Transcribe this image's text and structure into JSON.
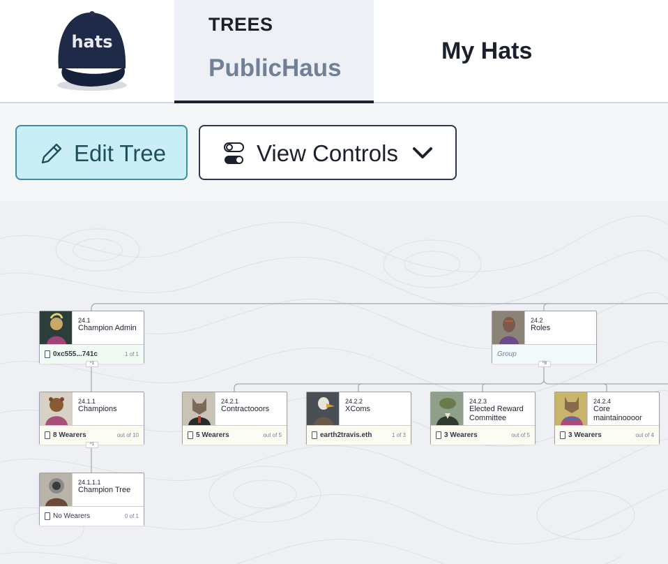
{
  "header": {
    "logo_text": "hats",
    "tab_trees": {
      "label": "TREES",
      "sub": "PublicHaus"
    },
    "tab_my_hats": "My Hats"
  },
  "toolbar": {
    "edit_label": "Edit Tree",
    "view_label": "View Controls"
  },
  "colors": {
    "edit_bg": "#c9eef5",
    "edit_border": "#3c8ea4",
    "text_dark": "#1a202c",
    "tab_active_bg": "#edf1f5"
  },
  "hats": [
    {
      "id": "24.1",
      "name": "Champion Admin",
      "footer": "0xc555...741c",
      "count": "1 of 1",
      "toggle": "^1"
    },
    {
      "id": "24.2",
      "name": "Roles",
      "footer": "Group",
      "toggle": "^8"
    },
    {
      "id": "24.1.1",
      "name": "Champions",
      "footer": "8 Wearers",
      "count": "out of 10",
      "toggle": "^1"
    },
    {
      "id": "24.2.1",
      "name": "Contractooors",
      "footer": "5 Wearers",
      "count": "out of 5"
    },
    {
      "id": "24.2.2",
      "name": "XComs",
      "footer": "earth2travis.eth",
      "count": "1 of 3"
    },
    {
      "id": "24.2.3",
      "name": "Elected Reward Committee",
      "footer": "3 Wearers",
      "count": "out of 5"
    },
    {
      "id": "24.2.4",
      "name": "Core maintainoooor",
      "footer": "3 Wearers",
      "count": "out of 4"
    },
    {
      "id": "24.1.1.1",
      "name": "Champion Tree",
      "footer": "No Wearers",
      "count": "0 of 1"
    }
  ]
}
